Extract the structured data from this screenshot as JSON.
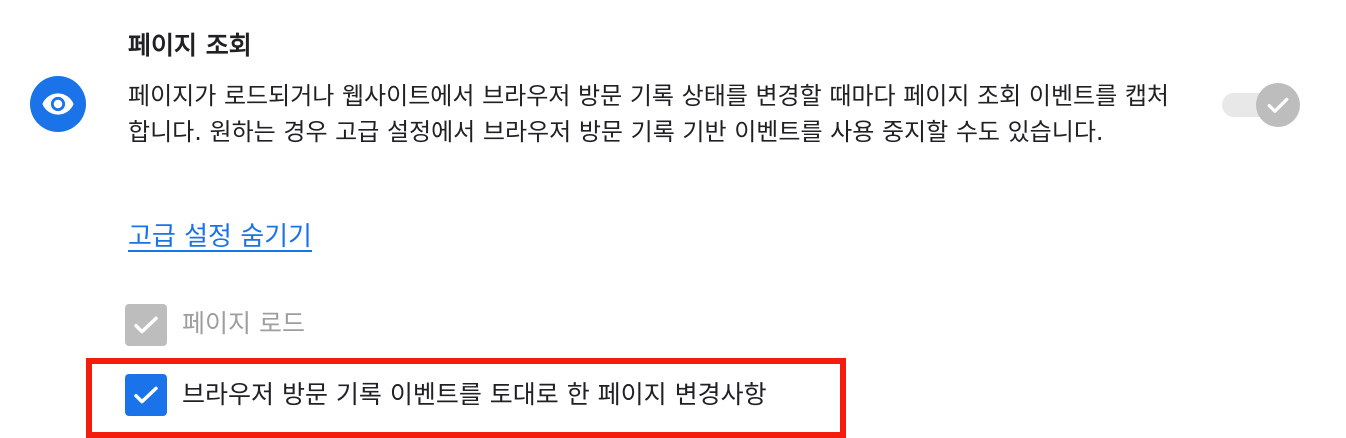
{
  "section": {
    "title": "페이지 조회",
    "description": "페이지가 로드되거나 웹사이트에서 브라우저 방문 기록 상태를 변경할 때마다 페이지 조회 이벤트를 캡처합니다. 원하는 경우 고급 설정에서 브라우저 방문 기록 기반 이벤트를 사용 중지할 수도 있습니다.",
    "icon": "eye-icon",
    "toggle": {
      "state": "on",
      "disabled": true
    }
  },
  "advanced": {
    "link_label": "고급 설정 숨기기",
    "options": [
      {
        "label": "페이지 로드",
        "checked": true,
        "disabled": true
      },
      {
        "label": "브라우저 방문 기록 이벤트를 토대로 한 페이지 변경사항",
        "checked": true,
        "disabled": false
      }
    ]
  },
  "colors": {
    "accent": "#1a73e8",
    "disabled": "#bdbdbd",
    "highlight": "#f41c0c",
    "text": "#202124"
  }
}
